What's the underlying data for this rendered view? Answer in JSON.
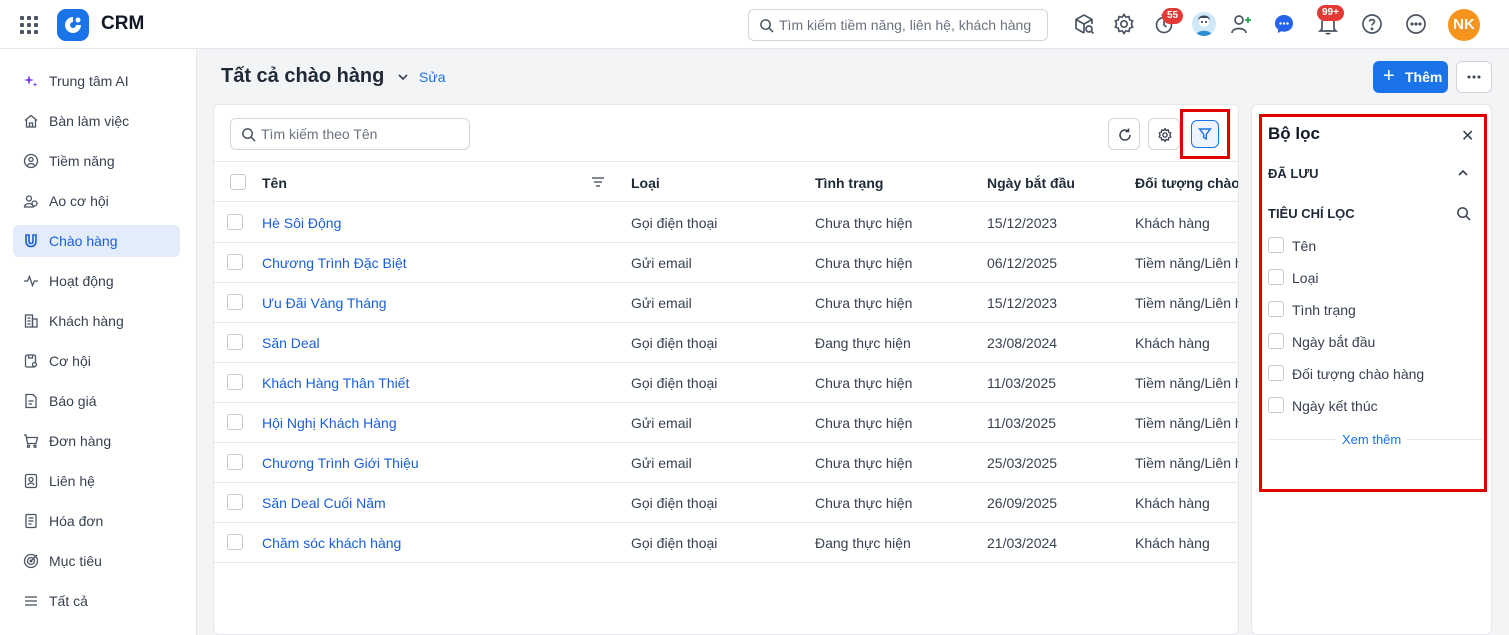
{
  "topbar": {
    "app_title": "CRM",
    "search_placeholder": "Tìm kiếm tiềm năng, liên hệ, khách hàng",
    "badges": {
      "reminders": "55",
      "notifications": "99+"
    },
    "user_initials": "NK"
  },
  "sidebar": {
    "items": [
      {
        "label": "Trung tâm AI",
        "icon": "sparkle-icon"
      },
      {
        "label": "Bàn làm việc",
        "icon": "home-icon"
      },
      {
        "label": "Tiềm năng",
        "icon": "target-user-icon"
      },
      {
        "label": "Ao cơ hội",
        "icon": "users-icon"
      },
      {
        "label": "Chào hàng",
        "icon": "magnet-icon",
        "active": true
      },
      {
        "label": "Hoạt động",
        "icon": "activity-icon"
      },
      {
        "label": "Khách hàng",
        "icon": "building-icon"
      },
      {
        "label": "Cơ hội",
        "icon": "opportunity-icon"
      },
      {
        "label": "Báo giá",
        "icon": "quote-icon"
      },
      {
        "label": "Đơn hàng",
        "icon": "cart-icon"
      },
      {
        "label": "Liên hệ",
        "icon": "contact-icon"
      },
      {
        "label": "Hóa đơn",
        "icon": "invoice-icon"
      },
      {
        "label": "Mục tiêu",
        "icon": "goal-icon"
      },
      {
        "label": "Tất cả",
        "icon": "menu-icon"
      }
    ]
  },
  "header": {
    "title": "Tất cả chào hàng",
    "edit_label": "Sửa",
    "add_label": "Thêm"
  },
  "table": {
    "search_placeholder": "Tìm kiếm theo Tên",
    "columns": [
      "Tên",
      "Loại",
      "Tình trạng",
      "Ngày bắt đầu",
      "Đối tượng chào h"
    ],
    "rows": [
      [
        "Hè Sôi Động",
        "Gọi điện thoại",
        "Chưa thực hiện",
        "15/12/2023",
        "Khách hàng"
      ],
      [
        "Chương Trình Đặc Biệt",
        "Gửi email",
        "Chưa thực hiện",
        "06/12/2025",
        "Tiềm năng/Liên h"
      ],
      [
        "Ưu Đãi Vàng Tháng",
        "Gửi email",
        "Chưa thực hiện",
        "15/12/2023",
        "Tiềm năng/Liên h"
      ],
      [
        "Săn Deal",
        "Gọi điện thoại",
        "Đang thực hiện",
        "23/08/2024",
        "Khách hàng"
      ],
      [
        "Khách Hàng Thân Thiết",
        "Gọi điện thoại",
        "Chưa thực hiện",
        "11/03/2025",
        "Tiềm năng/Liên h"
      ],
      [
        "Hội Nghị Khách Hàng",
        "Gửi email",
        "Chưa thực hiện",
        "11/03/2025",
        "Tiềm năng/Liên h"
      ],
      [
        "Chương Trình Giới Thiệu",
        "Gửi email",
        "Chưa thực hiện",
        "25/03/2025",
        "Tiềm năng/Liên h"
      ],
      [
        "Săn Deal Cuối Năm",
        "Gọi điện thoại",
        "Chưa thực hiện",
        "26/09/2025",
        "Khách hàng"
      ],
      [
        "Chăm sóc khách hàng",
        "Gọi điện thoại",
        "Đang thực hiện",
        "21/03/2024",
        "Khách hàng"
      ]
    ]
  },
  "filter_panel": {
    "title": "Bộ lọc",
    "saved_label": "ĐÃ LƯU",
    "criteria_label": "TIÊU CHÍ LỌC",
    "criteria": [
      "Tên",
      "Loại",
      "Tình trạng",
      "Ngày bắt đầu",
      "Đối tượng chào hàng",
      "Ngày kết thúc"
    ],
    "more_label": "Xem thêm"
  },
  "colors": {
    "accent": "#1a73e8",
    "highlight": "#e00000",
    "active_bg": "#e3ecfb"
  }
}
